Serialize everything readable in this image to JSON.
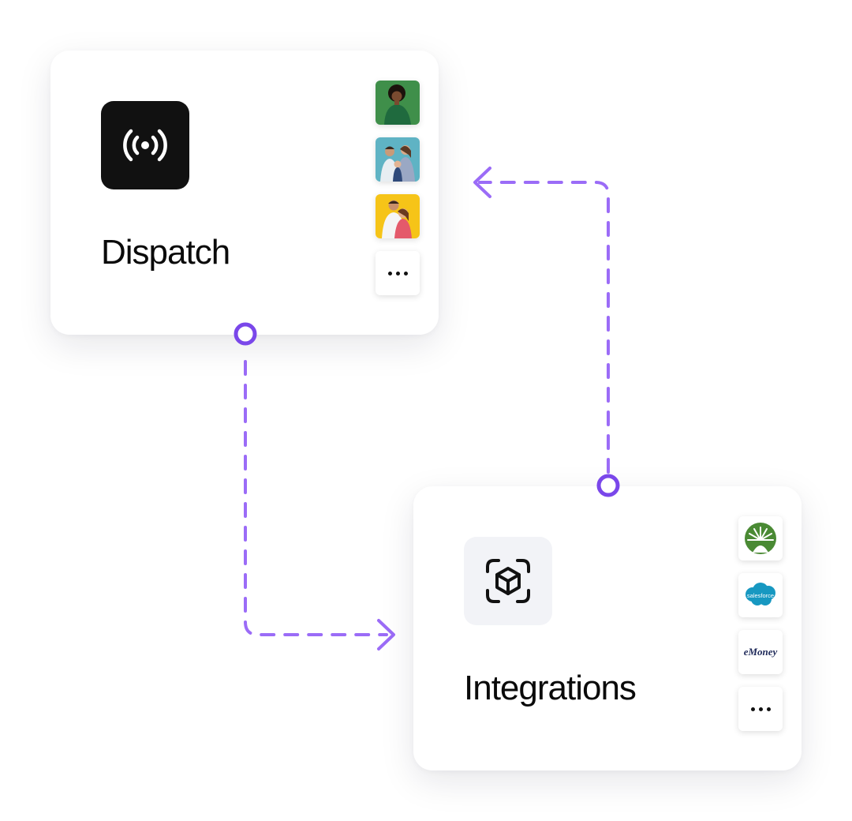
{
  "nodes": {
    "dispatch": {
      "title": "Dispatch",
      "icon": "broadcast-icon",
      "tiles": [
        "person-photo",
        "family-photo",
        "couple-photo",
        "more-options"
      ]
    },
    "integrations": {
      "title": "Integrations",
      "icon": "cube-scan-icon",
      "tiles": [
        "fidelity-logo",
        "salesforce-logo",
        "emoney-logo",
        "more-options"
      ],
      "logos": {
        "salesforce": "salesforce",
        "emoney": "eMoney"
      }
    }
  },
  "edges": [
    {
      "from": "dispatch",
      "to": "integrations",
      "style": "dashed",
      "color": "#9b6cf7"
    },
    {
      "from": "integrations",
      "to": "dispatch",
      "style": "dashed",
      "color": "#9b6cf7"
    }
  ],
  "colors": {
    "connector": "#9b6cf7",
    "port": "#7a47ea",
    "dark_icon_bg": "#111111",
    "light_icon_bg": "#f2f3f7"
  }
}
